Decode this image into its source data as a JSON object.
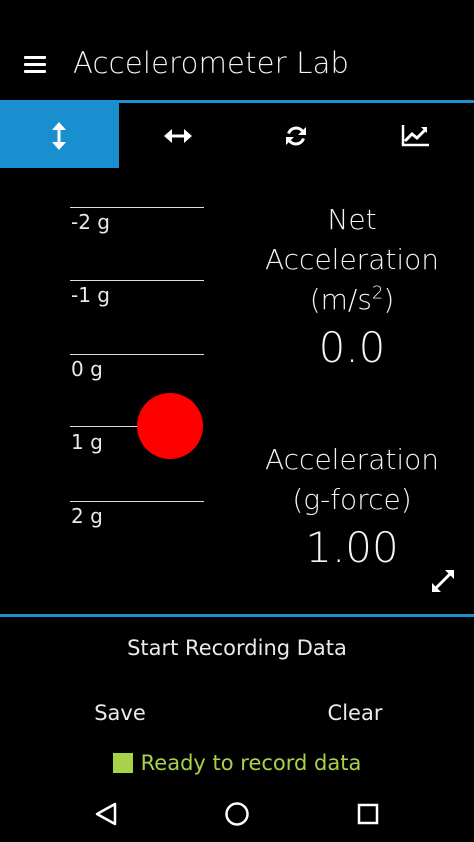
{
  "app": {
    "title": "Accelerometer Lab"
  },
  "icons": {
    "menu": "menu-icon",
    "expand": "expand-icon",
    "back": "back-triangle-icon",
    "home": "home-circle-icon",
    "recents": "recents-square-icon"
  },
  "tabs": [
    {
      "icon": "vertical-arrows-icon",
      "active": true
    },
    {
      "icon": "horizontal-arrows-icon",
      "active": false
    },
    {
      "icon": "refresh-icon",
      "active": false
    },
    {
      "icon": "line-chart-icon",
      "active": false
    }
  ],
  "scale": {
    "ticks": [
      "-2 g",
      "-1 g",
      "0 g",
      "1 g",
      "2 g"
    ]
  },
  "readouts": {
    "net_label_1": "Net",
    "net_label_2": "Acceleration",
    "net_unit_base": "(m/s",
    "net_unit_exp": "2",
    "net_unit_close": ")",
    "net_value": "0.0",
    "g_label_1": "Acceleration",
    "g_label_2": "(g-force)",
    "g_value": "1.00"
  },
  "controls": {
    "start_recording": "Start Recording Data",
    "save": "Save",
    "clear": "Clear"
  },
  "status": {
    "text": "Ready to record data",
    "color": "#a8d24a"
  },
  "colors": {
    "accent": "#1a8fd0",
    "indicator": "#ff0000",
    "status": "#a8d24a"
  }
}
